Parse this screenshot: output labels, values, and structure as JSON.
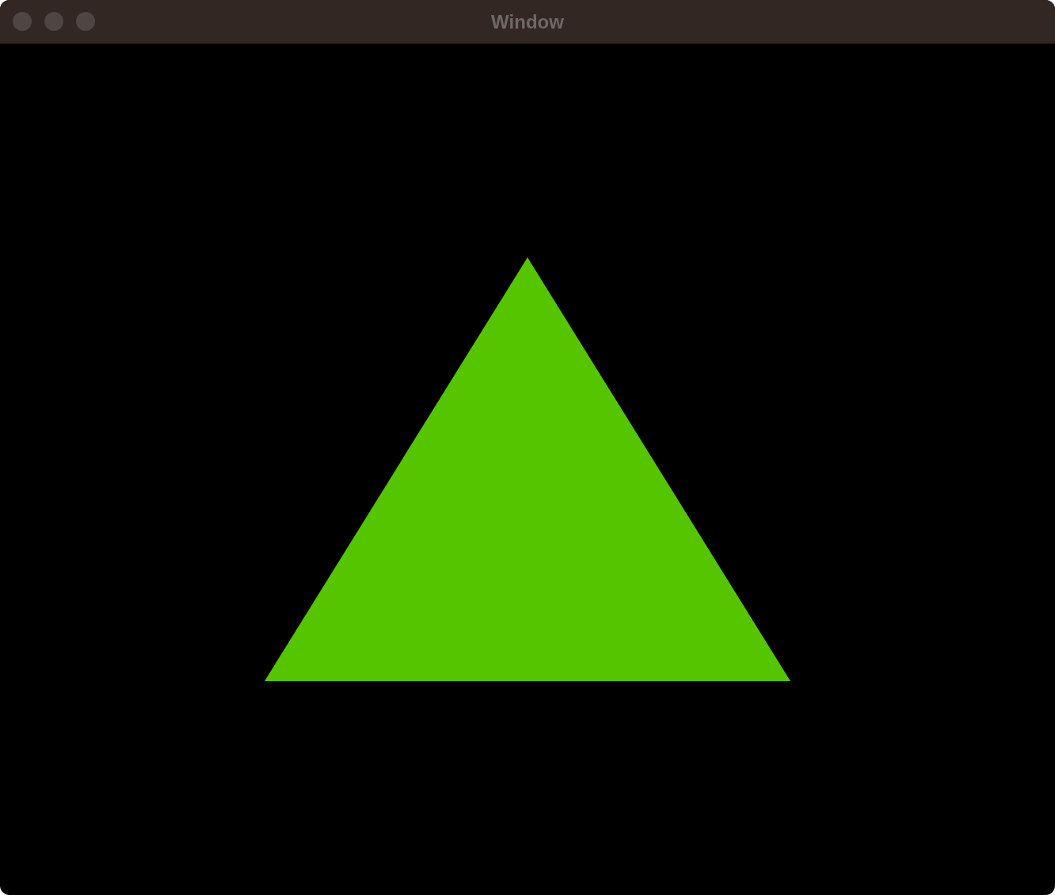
{
  "window": {
    "title": "Window"
  }
}
